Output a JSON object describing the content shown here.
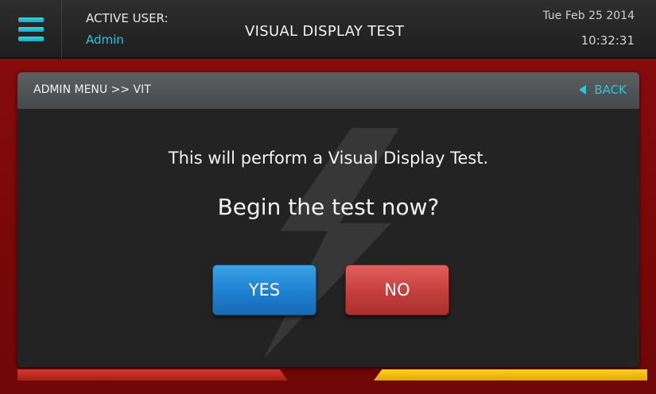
{
  "header": {
    "menu_icon": "hamburger-menu-icon",
    "active_user_label": "ACTIVE USER:",
    "active_user_name": "Admin",
    "title": "VISUAL DISPLAY TEST",
    "date": "Tue Feb 25 2014",
    "time": "10:32:31"
  },
  "panel": {
    "breadcrumb": "ADMIN MENU >> VIT",
    "back_label": "BACK",
    "back_icon": "triangle-left-icon",
    "message": "This will perform a Visual Display Test.",
    "question": "Begin the test now?",
    "yes_label": "YES",
    "no_label": "NO"
  },
  "colors": {
    "accent_cyan": "#29c6dd",
    "yes_blue": "#1f7fcf",
    "no_red": "#c43e3c",
    "frame_red": "#7a0808",
    "stripe_yellow": "#f9d21a"
  }
}
